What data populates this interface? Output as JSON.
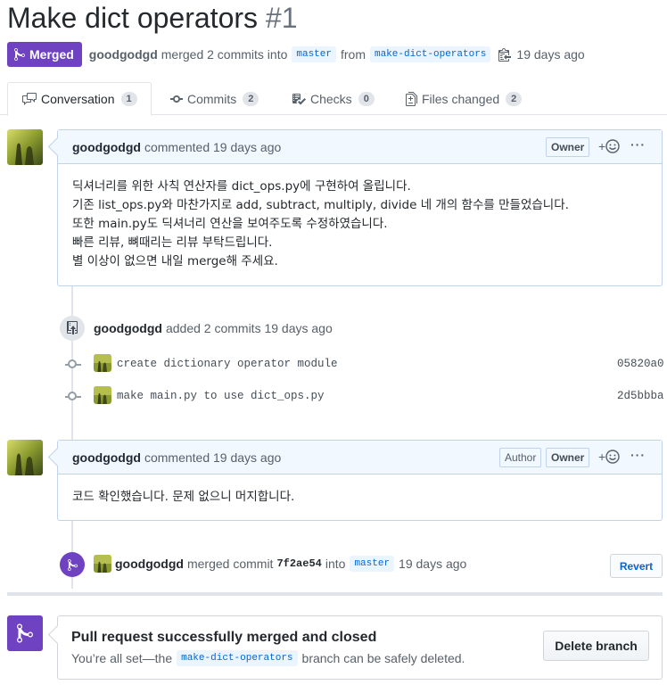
{
  "pr": {
    "title": "Make dict operators",
    "number": "#1",
    "state": "Merged",
    "author": "goodgodgd",
    "merge_text": "merged 2 commits into",
    "base_branch": "master",
    "from_text": "from",
    "head_branch": "make-dict-operators",
    "time": "19 days ago"
  },
  "tabs": [
    {
      "label": "Conversation",
      "count": "1",
      "icon": "comment-discussion-icon"
    },
    {
      "label": "Commits",
      "count": "2",
      "icon": "git-commit-icon"
    },
    {
      "label": "Checks",
      "count": "0",
      "icon": "checklist-icon"
    },
    {
      "label": "Files changed",
      "count": "2",
      "icon": "diff-icon"
    }
  ],
  "comment1": {
    "author": "goodgodgd",
    "action": "commented 19 days ago",
    "label": "Owner",
    "reaction": "+",
    "more": "···",
    "lines": [
      "딕셔너리를 위한 사칙 연산자를 dict_ops.py에 구현하여 올립니다.",
      "기존 list_ops.py와 마찬가지로 add, subtract, multiply, divide 네 개의 함수를 만들었습니다.",
      "또한 main.py도 딕셔너리 연산을 보여주도록 수정하였습니다.",
      "빠른 리뷰, 뼈때리는 리뷰 부탁드립니다.",
      "별 이상이 없으면 내일 merge해 주세요."
    ]
  },
  "commits_event": {
    "author": "goodgodgd",
    "action": "added 2 commits 19 days ago",
    "commits": [
      {
        "message": "create dictionary operator module",
        "sha": "05820a0"
      },
      {
        "message": "make main.py to use dict_ops.py",
        "sha": "2d5bbba"
      }
    ]
  },
  "comment2": {
    "author": "goodgodgd",
    "action": "commented 19 days ago",
    "label_author": "Author",
    "label_owner": "Owner",
    "reaction": "+",
    "more": "···",
    "body": "코드 확인했습니다. 문제 없으니 머지합니다."
  },
  "merge_event": {
    "author": "goodgodgd",
    "merged_text": "merged commit",
    "sha": "7f2ae54",
    "into_text": "into",
    "branch": "master",
    "time": "19 days ago",
    "revert_label": "Revert"
  },
  "merge_status": {
    "title": "Pull request successfully merged and closed",
    "desc_prefix": "You’re all set—the",
    "branch": "make-dict-operators",
    "desc_suffix": "branch can be safely deleted.",
    "delete_label": "Delete branch"
  },
  "colors": {
    "merged": "#6f42c1",
    "link": "#0366d6",
    "header_bg": "#f1f8ff"
  }
}
